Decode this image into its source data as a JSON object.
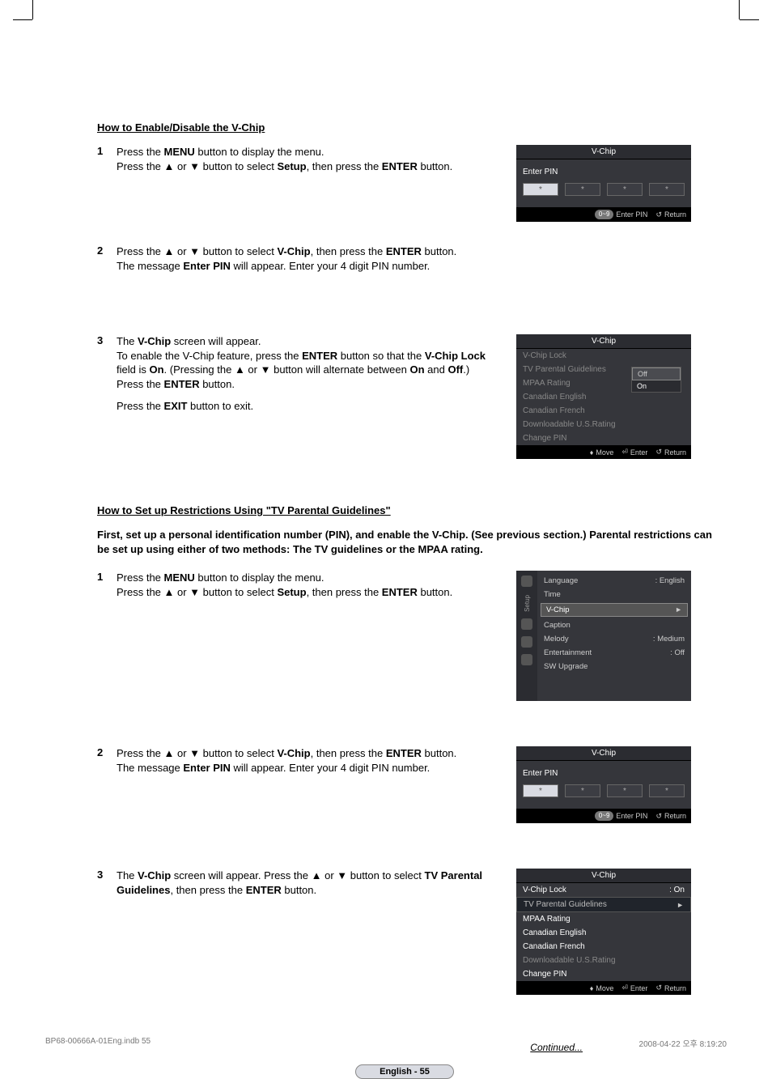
{
  "section1": {
    "title": "How to Enable/Disable the V-Chip",
    "steps": [
      {
        "n": "1",
        "html": "Press the <b>MENU</b> button to display the menu.<br>Press the ▲ or ▼ button to select <b>Setup</b>, then press the <b>ENTER</b> button."
      },
      {
        "n": "2",
        "html": "Press the ▲ or ▼ button to select <b>V-Chip</b>, then press the <b>ENTER</b> button.<br>The message <b>Enter PIN</b> will appear. Enter your 4 digit PIN number."
      },
      {
        "n": "3",
        "html": "The <b>V-Chip</b> screen will appear.<br>To enable the V-Chip feature, press the <b>ENTER</b> button so that the <b>V-Chip Lock</b> field is <b>On</b>. (Pressing the ▲ or ▼ button will alternate between <b>On</b> and <b>Off</b>.)<br>Press the <b>ENTER</b> button.",
        "extra": "Press the <b>EXIT</b> button to exit."
      }
    ]
  },
  "section2": {
    "title": "How to Set up Restrictions Using \"TV Parental Guidelines\"",
    "intro": "First, set up a personal identification number (PIN), and enable the V-Chip. (See previous section.) Parental restrictions can be set up using either of two methods: The TV guidelines or the MPAA rating.",
    "steps": [
      {
        "n": "1",
        "html": "Press the <b>MENU</b> button to display the menu.<br>Press the ▲ or ▼ button to select <b>Setup</b>, then press the <b>ENTER</b> button."
      },
      {
        "n": "2",
        "html": "Press the ▲ or ▼ button to select <b>V-Chip</b>, then press the <b>ENTER</b> button.<br>The message <b>Enter PIN</b> will appear. Enter your 4 digit PIN number."
      },
      {
        "n": "3",
        "html": "The <b>V-Chip</b> screen will appear. Press the ▲ or ▼ button to select <b>TV Parental Guidelines</b>, then press the <b>ENTER</b> button."
      }
    ]
  },
  "osd": {
    "vchip_title": "V-Chip",
    "enter_pin": "Enter PIN",
    "footer": {
      "number_pill": "0~9",
      "enterpin": "Enter PIN",
      "return": "Return",
      "move": "Move",
      "enter": "Enter",
      "return_icon": "↺",
      "move_icon": "♦",
      "enter_icon": "⏎"
    },
    "menu_items": {
      "vchip_lock": "V-Chip Lock",
      "tv_pg": "TV Parental Guidelines",
      "mpaa": "MPAA Rating",
      "can_en": "Canadian English",
      "can_fr": "Canadian French",
      "dl_us": "Downloadable U.S.Rating",
      "change_pin": "Change PIN",
      "on": "On",
      "off": "Off",
      "on_val": ": On"
    },
    "setup_menu": {
      "side": "Setup",
      "language": "Language",
      "language_v": ": English",
      "time": "Time",
      "vchip": "V-Chip",
      "caption": "Caption",
      "melody": "Melody",
      "melody_v": ": Medium",
      "ent": "Entertainment",
      "ent_v": ": Off",
      "sw": "SW Upgrade"
    }
  },
  "continued": "Continued...",
  "page_badge": "English - 55",
  "print_footer": {
    "file": "BP68-00666A-01Eng.indb   55",
    "time": "2008-04-22   오후 8:19:20"
  }
}
